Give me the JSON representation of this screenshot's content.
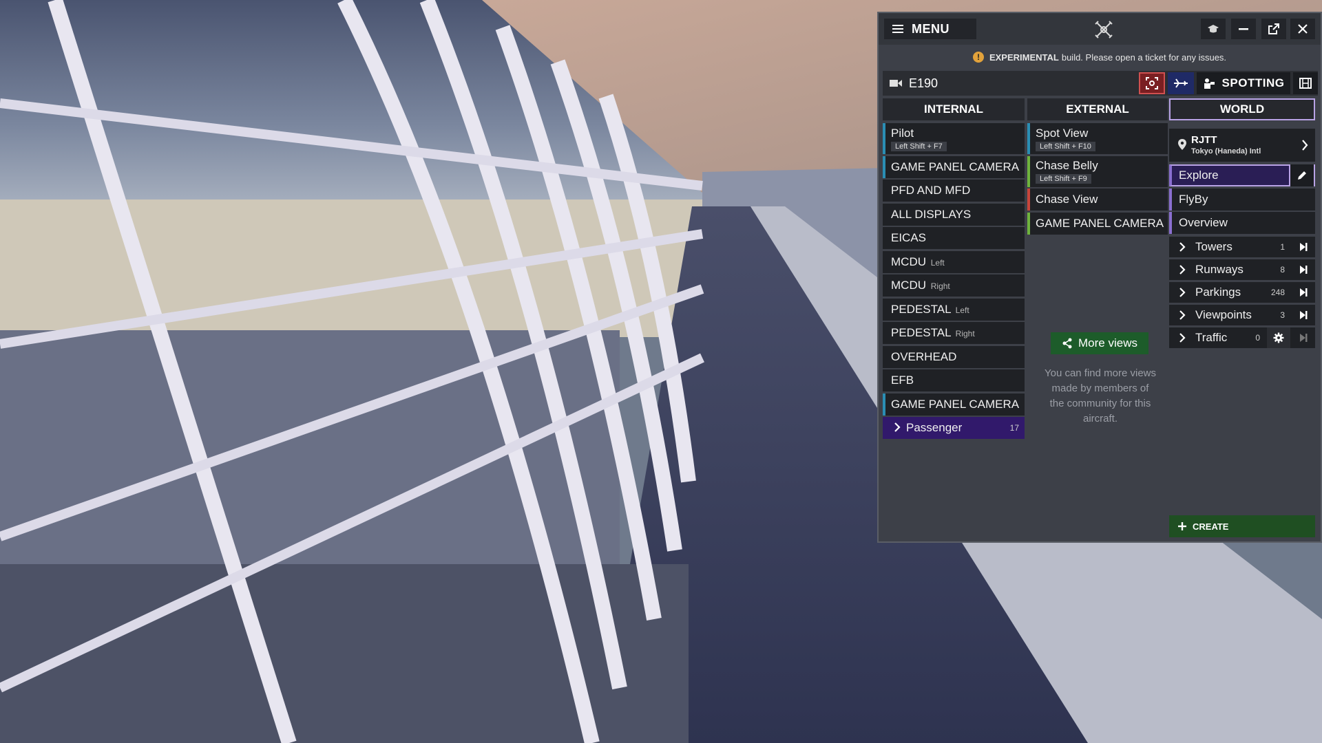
{
  "titlebar": {
    "menu_label": "MENU"
  },
  "notice": {
    "bold": "EXPERIMENTAL",
    "text": "build. Please open a ticket for any issues."
  },
  "aircraft": {
    "name": "E190",
    "spotting_label": "SPOTTING"
  },
  "columns": {
    "internal": "INTERNAL",
    "external": "EXTERNAL",
    "world": "WORLD"
  },
  "internal": {
    "pilot": {
      "label": "Pilot",
      "key": "Left Shift + F7"
    },
    "items": [
      {
        "label": "GAME PANEL CAMERA",
        "sub": ""
      },
      {
        "label": "PFD AND MFD",
        "sub": ""
      },
      {
        "label": "ALL DISPLAYS",
        "sub": ""
      },
      {
        "label": "EICAS",
        "sub": ""
      },
      {
        "label": "MCDU",
        "sub": "Left"
      },
      {
        "label": "MCDU",
        "sub": "Right"
      },
      {
        "label": "PEDESTAL",
        "sub": "Left"
      },
      {
        "label": "PEDESTAL",
        "sub": "Right"
      },
      {
        "label": "OVERHEAD",
        "sub": ""
      },
      {
        "label": "EFB",
        "sub": ""
      },
      {
        "label": "GAME PANEL CAMERA",
        "sub": ""
      }
    ],
    "passenger": {
      "label": "Passenger",
      "count": "17"
    }
  },
  "external": {
    "spot": {
      "label": "Spot View",
      "key": "Left Shift + F10"
    },
    "chase_belly": {
      "label": "Chase Belly",
      "key": "Left Shift + F9"
    },
    "chase_view": {
      "label": "Chase View"
    },
    "game_panel": {
      "label": "GAME PANEL CAMERA"
    },
    "more_views": "More views",
    "more_text": "You can find more views made by members of the community for this aircraft."
  },
  "world": {
    "code": "RJTT",
    "city": "Tokyo (Haneda) Intl",
    "views": [
      "Explore",
      "FlyBy",
      "Overview"
    ],
    "groups": [
      {
        "label": "Towers",
        "count": "1"
      },
      {
        "label": "Runways",
        "count": "8"
      },
      {
        "label": "Parkings",
        "count": "248"
      },
      {
        "label": "Viewpoints",
        "count": "3"
      },
      {
        "label": "Traffic",
        "count": "0"
      }
    ],
    "create_label": "CREATE"
  },
  "colors": {
    "accent_blue": "#2a8eb4",
    "accent_green": "#6fb33d",
    "accent_red": "#c8453b",
    "accent_purple": "#8a6fd0",
    "passenger_bg": "#31196b",
    "create_green": "#1f4f22"
  }
}
